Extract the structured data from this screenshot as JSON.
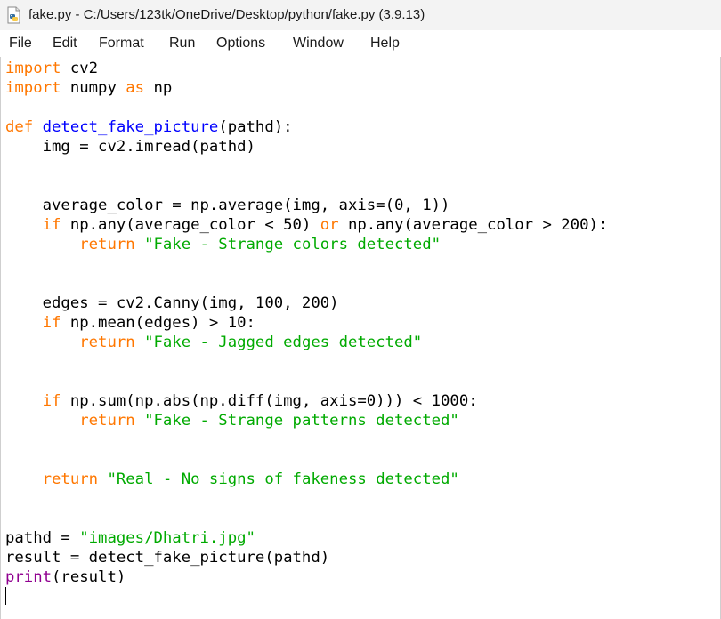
{
  "window": {
    "title": "fake.py - C:/Users/123tk/OneDrive/Desktop/python/fake.py (3.9.13)",
    "icon": "python-file-icon"
  },
  "menu": {
    "items": [
      "File",
      "Edit",
      "Format",
      "Run",
      "Options",
      "Window",
      "Help"
    ]
  },
  "colors": {
    "keyword": "#ff7700",
    "function_name": "#0000ff",
    "string": "#00aa00",
    "builtin": "#900090"
  },
  "code": {
    "lines": [
      [
        {
          "t": "import",
          "c": "kw"
        },
        {
          "t": " cv2"
        }
      ],
      [
        {
          "t": "import",
          "c": "kw"
        },
        {
          "t": " numpy "
        },
        {
          "t": "as",
          "c": "kw"
        },
        {
          "t": " np"
        }
      ],
      [],
      [
        {
          "t": "def",
          "c": "kw"
        },
        {
          "t": " "
        },
        {
          "t": "detect_fake_picture",
          "c": "fn"
        },
        {
          "t": "(pathd):"
        }
      ],
      [
        {
          "t": "    img = cv2.imread(pathd)"
        }
      ],
      [],
      [],
      [
        {
          "t": "    average_color = np.average(img, axis=(0, 1))"
        }
      ],
      [
        {
          "t": "    "
        },
        {
          "t": "if",
          "c": "kw"
        },
        {
          "t": " np.any(average_color < 50) "
        },
        {
          "t": "or",
          "c": "kw"
        },
        {
          "t": " np.any(average_color > 200):"
        }
      ],
      [
        {
          "t": "        "
        },
        {
          "t": "return",
          "c": "kw"
        },
        {
          "t": " "
        },
        {
          "t": "\"Fake - Strange colors detected\"",
          "c": "str"
        }
      ],
      [],
      [],
      [
        {
          "t": "    edges = cv2.Canny(img, 100, 200)"
        }
      ],
      [
        {
          "t": "    "
        },
        {
          "t": "if",
          "c": "kw"
        },
        {
          "t": " np.mean(edges) > 10:"
        }
      ],
      [
        {
          "t": "        "
        },
        {
          "t": "return",
          "c": "kw"
        },
        {
          "t": " "
        },
        {
          "t": "\"Fake - Jagged edges detected\"",
          "c": "str"
        }
      ],
      [],
      [],
      [
        {
          "t": "    "
        },
        {
          "t": "if",
          "c": "kw"
        },
        {
          "t": " np.sum(np.abs(np.diff(img, axis=0))) < 1000:"
        }
      ],
      [
        {
          "t": "        "
        },
        {
          "t": "return",
          "c": "kw"
        },
        {
          "t": " "
        },
        {
          "t": "\"Fake - Strange patterns detected\"",
          "c": "str"
        }
      ],
      [],
      [],
      [
        {
          "t": "    "
        },
        {
          "t": "return",
          "c": "kw"
        },
        {
          "t": " "
        },
        {
          "t": "\"Real - No signs of fakeness detected\"",
          "c": "str"
        }
      ],
      [],
      [],
      [
        {
          "t": "pathd = "
        },
        {
          "t": "\"images/Dhatri.jpg\"",
          "c": "str"
        }
      ],
      [
        {
          "t": "result = detect_fake_picture(pathd)"
        }
      ],
      [
        {
          "t": "print",
          "c": "bi"
        },
        {
          "t": "(result)"
        }
      ]
    ]
  }
}
